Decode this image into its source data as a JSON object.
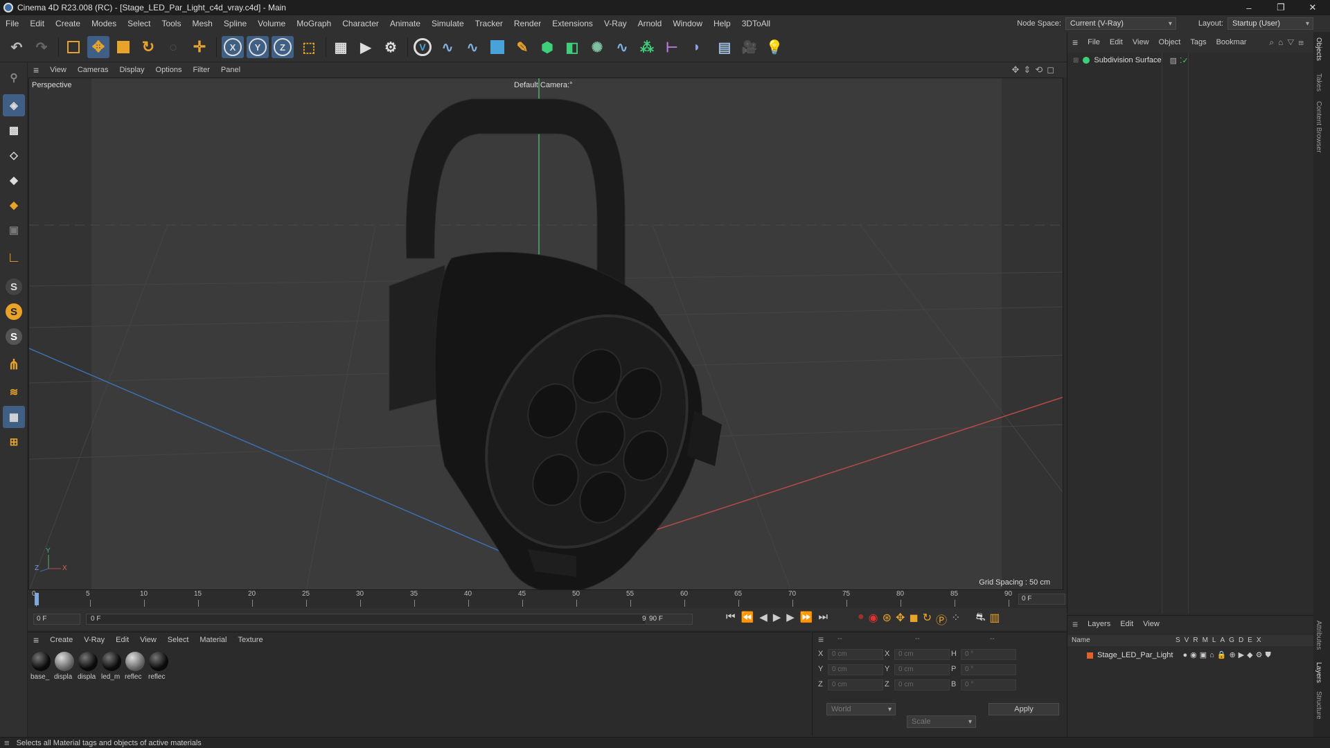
{
  "window": {
    "title": "Cinema 4D R23.008 (RC) - [Stage_LED_Par_Light_c4d_vray.c4d] - Main",
    "controls": {
      "minimize": "–",
      "restore": "❐",
      "close": "✕"
    }
  },
  "menubar": {
    "items": [
      "File",
      "Edit",
      "Create",
      "Modes",
      "Select",
      "Tools",
      "Mesh",
      "Spline",
      "Volume",
      "MoGraph",
      "Character",
      "Animate",
      "Simulate",
      "Tracker",
      "Render",
      "Extensions",
      "V-Ray",
      "Arnold",
      "Window",
      "Help",
      "3DToAll"
    ],
    "node_space_label": "Node Space:",
    "node_space_value": "Current (V-Ray)",
    "layout_label": "Layout:",
    "layout_value": "Startup (User)"
  },
  "toolbar": {
    "icons": [
      "undo-icon",
      "redo-icon",
      "select-icon",
      "move-icon",
      "scale-icon",
      "rotate-icon",
      "live-select-icon",
      "add-icon",
      "x-axis-icon",
      "y-axis-icon",
      "z-axis-icon",
      "coordinate-system-icon",
      "render-view-icon",
      "render-picture-viewer-icon",
      "render-settings-icon",
      "vray-icon",
      "python-icon",
      "python-icon",
      "cube-icon",
      "pen-icon",
      "subdivision-icon",
      "extrude-icon",
      "cloner-icon",
      "python-icon",
      "mograph-icon",
      "symmetry-icon",
      "deformer-icon",
      "floor-icon",
      "camera-icon",
      "light-icon"
    ],
    "axis_x": "X",
    "axis_y": "Y",
    "axis_z": "Z"
  },
  "viewport": {
    "menu": [
      "View",
      "Cameras",
      "Display",
      "Options",
      "Filter",
      "Panel"
    ],
    "label": "Perspective",
    "camera": "Default Camera",
    "camera_suffix": ":°",
    "grid_spacing": "Grid Spacing : 50 cm",
    "axis_labels": {
      "y": "Y",
      "z": "Z",
      "x": "X"
    },
    "colors": {
      "background": "#3b3b3b",
      "x_axis": "#b84a4a",
      "z_axis": "#3e6fb0",
      "y_axis": "#4caf70"
    }
  },
  "timeline": {
    "ticks": [
      "0",
      "5",
      "10",
      "15",
      "20",
      "25",
      "30",
      "35",
      "40",
      "45",
      "50",
      "55",
      "60",
      "65",
      "70",
      "75",
      "80",
      "85",
      "90"
    ],
    "current_frame": "0 F",
    "start_field": "0 F",
    "range_start": "0 F",
    "range_end": "90 F",
    "end_field": "90 F"
  },
  "materials": {
    "menu": [
      "Create",
      "V-Ray",
      "Edit",
      "View",
      "Select",
      "Material",
      "Texture"
    ],
    "items": [
      {
        "label": "base_",
        "tone": "dark"
      },
      {
        "label": "displa",
        "tone": "light"
      },
      {
        "label": "displa",
        "tone": "dark"
      },
      {
        "label": "led_m",
        "tone": "dark"
      },
      {
        "label": "reflec",
        "tone": "light"
      },
      {
        "label": "reflec",
        "tone": "dark"
      }
    ]
  },
  "coordinates": {
    "header_a": "--",
    "header_b": "--",
    "header_c": "--",
    "rows": [
      {
        "pos_label": "X",
        "pos": "0 cm",
        "size_label": "X",
        "size": "0 cm",
        "rot_label": "H",
        "rot": "0 °"
      },
      {
        "pos_label": "Y",
        "pos": "0 cm",
        "size_label": "Y",
        "size": "0 cm",
        "rot_label": "P",
        "rot": "0 °"
      },
      {
        "pos_label": "Z",
        "pos": "0 cm",
        "size_label": "Z",
        "size": "0 cm",
        "rot_label": "B",
        "rot": "0 °"
      }
    ],
    "mode": "World",
    "scale": "Scale",
    "apply": "Apply"
  },
  "objects": {
    "menu": [
      "File",
      "Edit",
      "View",
      "Object",
      "Tags",
      "Bookmar"
    ],
    "items": [
      {
        "name": "Subdivision Surface"
      }
    ]
  },
  "layers": {
    "menu": [
      "Layers",
      "Edit",
      "View"
    ],
    "header_name": "Name",
    "columns": [
      "S",
      "V",
      "R",
      "M",
      "L",
      "A",
      "G",
      "D",
      "E",
      "X"
    ],
    "items": [
      {
        "name": "Stage_LED_Par_Light",
        "color": "#e0622a"
      }
    ]
  },
  "side_tabs": [
    "Objects",
    "Takes",
    "Content Browser",
    "Attributes",
    "Layers",
    "Structure"
  ],
  "status": {
    "text": "Selects all Material tags and objects of active materials"
  }
}
